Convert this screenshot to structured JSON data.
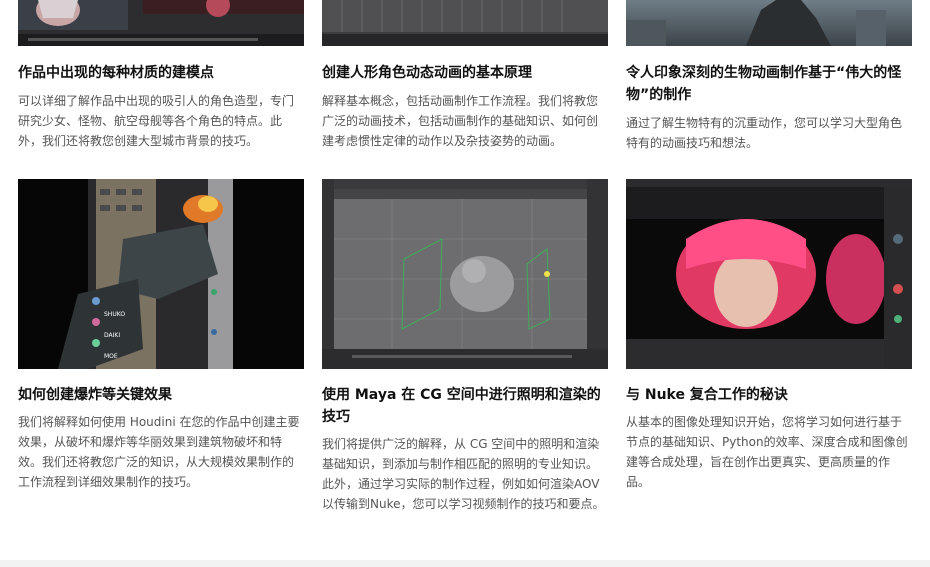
{
  "cards": [
    {
      "title": "作品中出现的每种材质的建模点",
      "desc": "可以详细了解作品中出现的吸引人的角色造型，专门研究少女、怪物、航空母舰等各个角色的特点。此外，我们还将教您创建大型城市背景的技巧。"
    },
    {
      "title": "创建人形角色动态动画的基本原理",
      "desc": "解释基本概念，包括动画制作工作流程。我们将教您广泛的动画技术，包括动画制作的基础知识、如何创建考虑惯性定律的动作以及杂技姿势的动画。"
    },
    {
      "title": "令人印象深刻的生物动画制作基于“伟大的怪物”的制作",
      "desc": "通过了解生物特有的沉重动作，您可以学习大型角色特有的动画技巧和想法。"
    },
    {
      "title": "如何创建爆炸等关键效果",
      "desc": "我们将解释如何使用 Houdini 在您的作品中创建主要效果，从破坏和爆炸等华丽效果到建筑物破坏和特效。我们还将教您广泛的知识，从大规模效果制作的工作流程到详细效果制作的技巧。"
    },
    {
      "title": "使用 Maya 在 CG 空间中进行照明和渲染的技巧",
      "desc": "我们将提供广泛的解释，从 CG 空间中的照明和渲染基础知识，到添加与制作相匹配的照明的专业知识。此外，通过学习实际的制作过程，例如如何渲染AOV以传输到Nuke，您可以学习视频制作的技巧和要点。"
    },
    {
      "title": "与 Nuke 复合工作的秘诀",
      "desc": "从基本的图像处理知识开始，您将学习如何进行基于节点的基础知识、Python的效率、深度合成和图像创建等合成处理，旨在创作出更真实、更高质量的作品。"
    }
  ],
  "chat_overlay": [
    "SHUKO",
    "DAIKI",
    "MOE"
  ]
}
